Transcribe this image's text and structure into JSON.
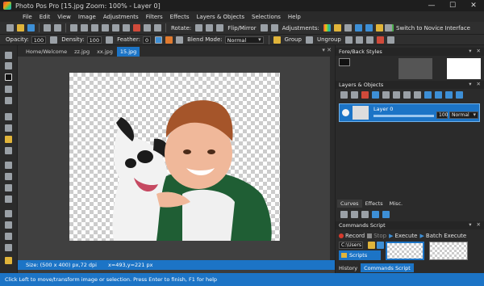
{
  "window": {
    "title": "Photo Pos Pro [15.jpg Zoom: 100% - Layer 0]",
    "minimize": "—",
    "maximize": "☐",
    "close": "✕"
  },
  "menu": [
    "File",
    "Edit",
    "View",
    "Image",
    "Adjustments",
    "Filters",
    "Effects",
    "Layers & Objects",
    "Selections",
    "Help"
  ],
  "toolbar": {
    "rotate_label": "Rotate:",
    "flip_label": "Flip/Mirror",
    "adjustments_label": "Adjustments:",
    "novice_label": "Switch to Novice Interface"
  },
  "options": {
    "opacity_label": "Opacity:",
    "opacity_value": "100",
    "density_label": "Density:",
    "density_value": "100",
    "feather_label": "Feather:",
    "feather_value": "0",
    "blend_label": "Blend Mode:",
    "blend_value": "Normal",
    "group_label": "Group",
    "ungroup_label": "Ungroup"
  },
  "doc_tabs": [
    "Home/Welcome",
    "zz.jpg",
    "xx.jpg",
    "15.jpg"
  ],
  "active_tab_index": 3,
  "doc_status": {
    "size": "Size: (500 x 400) px,72 dpi",
    "coords": "x=493,y=221 px"
  },
  "panels": {
    "fore_back": "Fore/Back Styles",
    "layers": "Layers & Objects",
    "layer_name": "Layer 0",
    "layer_opacity": "100",
    "layer_blend": "Normal",
    "sub_tabs": [
      "Curves",
      "Effects",
      "Misc."
    ],
    "commands": "Commands Script",
    "record_label": "Record",
    "stop_label": "Stop",
    "execute_label": "Execute",
    "batch_label": "Batch Execute",
    "path_value": "C:\\Users",
    "scripts_label": "Scripts",
    "bottom_tabs": [
      "History",
      "Commands Script"
    ],
    "active_bottom_tab": 1
  },
  "status_hint": "Click Left to move/transform image or selection. Press Enter to finish, F1 for help",
  "colors": {
    "accent": "#1c74c6",
    "background": "#2b2b2b"
  }
}
